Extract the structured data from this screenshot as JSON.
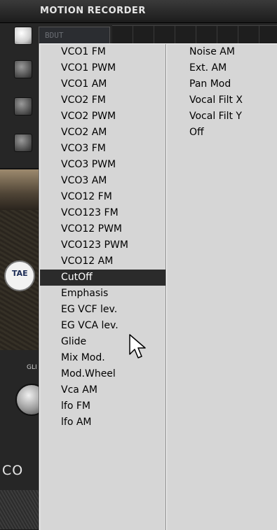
{
  "header": {
    "title": "MOTION RECORDER",
    "display_text": "BDUT"
  },
  "background": {
    "badge_text": "TAE",
    "knob_label": "GLI",
    "brand_text": "CO"
  },
  "menu": {
    "left_items": [
      {
        "label": "VCO1 FM"
      },
      {
        "label": "VCO1 PWM"
      },
      {
        "label": "VCO1 AM"
      },
      {
        "label": "VCO2 FM"
      },
      {
        "label": "VCO2 PWM"
      },
      {
        "label": "VCO2 AM"
      },
      {
        "label": "VCO3 FM"
      },
      {
        "label": "VCO3 PWM"
      },
      {
        "label": "VCO3 AM"
      },
      {
        "label": "VCO12 FM"
      },
      {
        "label": "VCO123 FM"
      },
      {
        "label": "VCO12 PWM"
      },
      {
        "label": "VCO123 PWM"
      },
      {
        "label": "VCO12 AM"
      },
      {
        "label": "CutOff",
        "selected": true
      },
      {
        "label": "Emphasis"
      },
      {
        "label": "EG VCF lev."
      },
      {
        "label": "EG VCA lev."
      },
      {
        "label": "Glide"
      },
      {
        "label": "Mix Mod."
      },
      {
        "label": "Mod.Wheel"
      },
      {
        "label": "Vca AM"
      },
      {
        "label": "lfo FM"
      },
      {
        "label": "lfo AM"
      }
    ],
    "right_items": [
      {
        "label": "Noise AM"
      },
      {
        "label": "Ext. AM"
      },
      {
        "label": "Pan Mod"
      },
      {
        "label": "Vocal Filt X"
      },
      {
        "label": "Vocal Filt Y"
      },
      {
        "label": "Off"
      }
    ],
    "selected_item": "CutOff"
  },
  "colors": {
    "menu_bg": "#d6d6d6",
    "highlight_bg": "#2b2b2b",
    "highlight_text": "#ffffff"
  },
  "icons": {
    "cursor": "arrow-cursor-icon"
  }
}
